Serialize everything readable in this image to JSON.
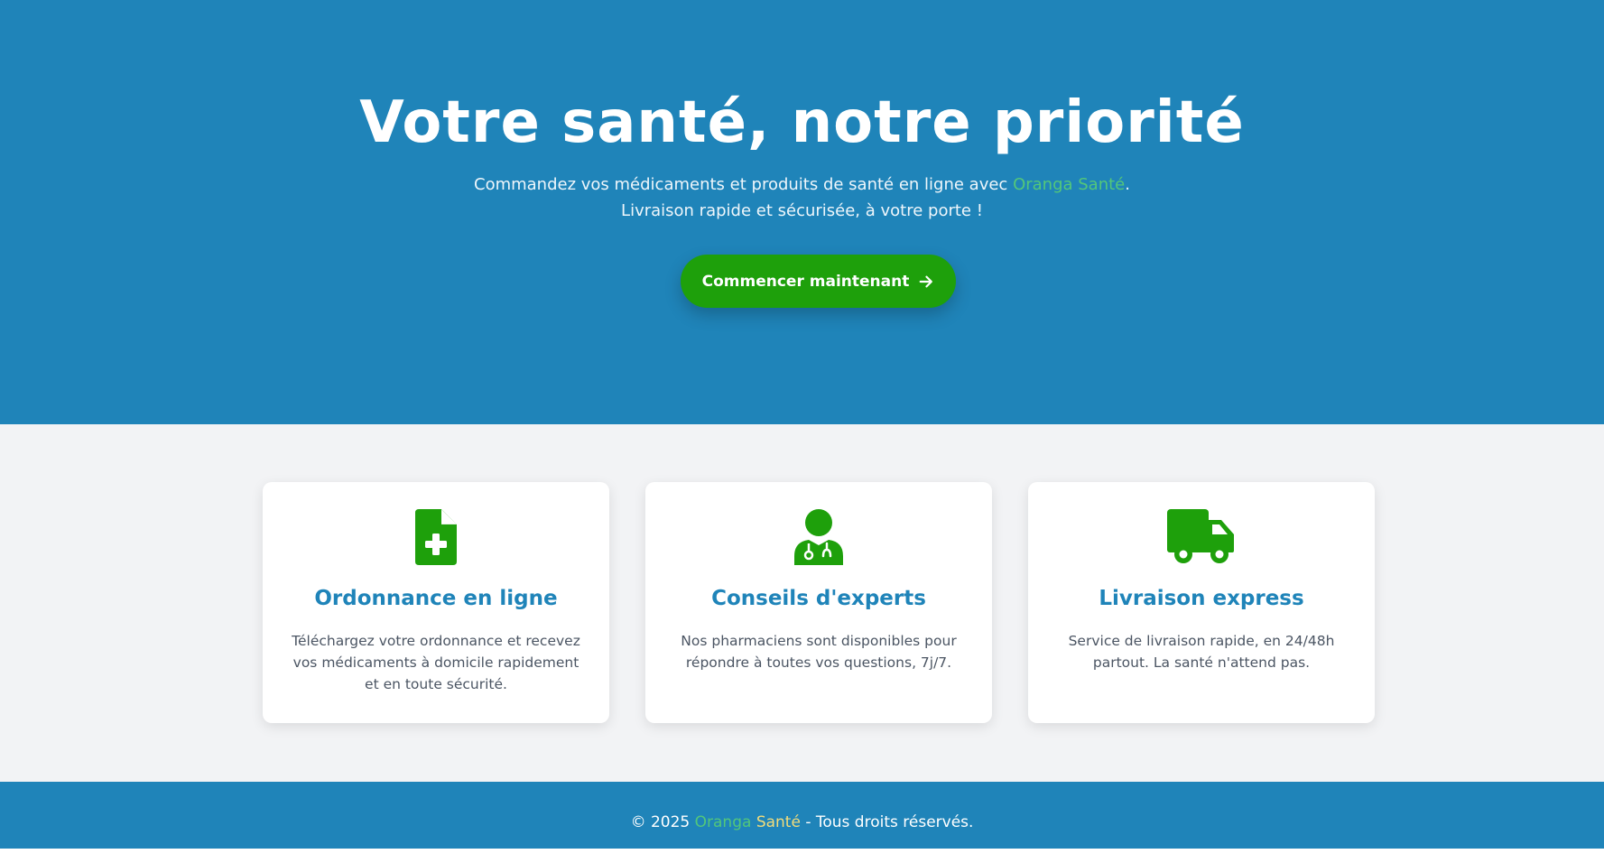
{
  "hero": {
    "title": "Votre santé, notre priorité",
    "subtitle_before": "Commandez vos médicaments et produits de santé en ligne avec ",
    "subtitle_brand": "Oranga Santé",
    "subtitle_after": ". Livraison rapide et sécurisée, à votre porte !",
    "cta_label": "Commencer maintenant",
    "cta_icon": "arrow-right-icon",
    "background_color": "#1f84b9",
    "cta_color": "#1ea00b"
  },
  "features": [
    {
      "icon": "prescription-file-icon",
      "title": "Ordonnance en ligne",
      "text": "Téléchargez votre ordonnance et recevez vos médicaments à domicile rapidement et en toute sécurité."
    },
    {
      "icon": "doctor-icon",
      "title": "Conseils d'experts",
      "text": "Nos pharmaciens sont disponibles pour répondre à toutes vos questions, 7j/7."
    },
    {
      "icon": "delivery-truck-icon",
      "title": "Livraison express",
      "text": "Service de livraison rapide, en 24/48h partout. La santé n'attend pas."
    }
  ],
  "footer": {
    "copyright": "© 2025 ",
    "brand_part1": "Oranga",
    "brand_part2": " Santé",
    "suffix": " - Tous droits réservés."
  },
  "colors": {
    "primary_blue": "#1f84b9",
    "accent_green": "#1ea00b",
    "brand_green": "#53c77a",
    "brand_yellow": "#f2dc7a"
  }
}
